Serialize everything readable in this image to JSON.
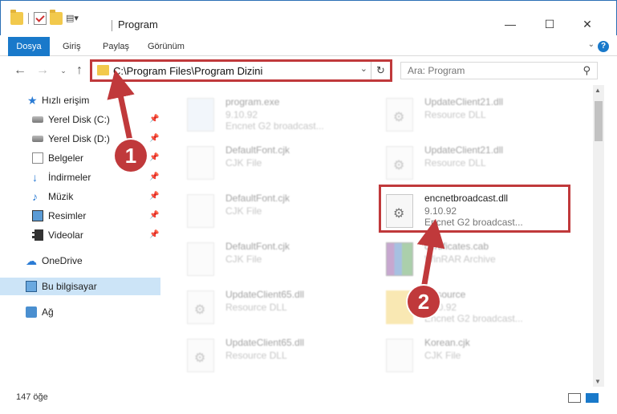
{
  "window": {
    "title": "Program",
    "minimize": "—",
    "maximize": "☐",
    "close": "✕"
  },
  "ribbon": {
    "tabs": [
      "Dosya",
      "Giriş",
      "Paylaş",
      "Görünüm"
    ],
    "help": "?"
  },
  "address": {
    "path": "C:\\Program Files\\Program Dizini",
    "search_placeholder": "Ara: Program"
  },
  "sidebar": {
    "items": [
      {
        "label": "Hızlı erişim",
        "icon": "star-icon"
      },
      {
        "label": "Yerel Disk (C:)",
        "icon": "disk-icon"
      },
      {
        "label": "Yerel Disk (D:)",
        "icon": "disk-icon"
      },
      {
        "label": "Belgeler",
        "icon": "documents-icon"
      },
      {
        "label": "İndirmeler",
        "icon": "download-icon"
      },
      {
        "label": "Müzik",
        "icon": "music-icon"
      },
      {
        "label": "Resimler",
        "icon": "pictures-icon"
      },
      {
        "label": "Videolar",
        "icon": "videos-icon"
      },
      {
        "label": "OneDrive",
        "icon": "cloud-icon"
      },
      {
        "label": "Bu bilgisayar",
        "icon": "computer-icon"
      },
      {
        "label": "Ağ",
        "icon": "network-icon"
      }
    ]
  },
  "files": [
    {
      "name": "program.exe",
      "line2": "9.10.92",
      "line3": "Encnet G2 broadcast..."
    },
    {
      "name": "UpdateClient21.dll",
      "line2": "Resource DLL",
      "line3": ""
    },
    {
      "name": "DefaultFont.cjk",
      "line2": "CJK File",
      "line3": ""
    },
    {
      "name": "UpdateClient21.dll",
      "line2": "Resource DLL",
      "line3": ""
    },
    {
      "name": "DefaultFont.cjk",
      "line2": "CJK File",
      "line3": ""
    },
    {
      "name": "encnetbroadcast.dll",
      "line2": "9.10.92",
      "line3": "Encnet G2 broadcast..."
    },
    {
      "name": "DefaultFont.cjk",
      "line2": "CJK File",
      "line3": ""
    },
    {
      "name": "certificates.cab",
      "line2": "WinRAR Archive",
      "line3": ""
    },
    {
      "name": "UpdateClient65.dll",
      "line2": "Resource DLL",
      "line3": ""
    },
    {
      "name": "Resource",
      "line2": "9.10.92",
      "line3": "Encnet G2 broadcast..."
    },
    {
      "name": "UpdateClient65.dll",
      "line2": "Resource DLL",
      "line3": ""
    },
    {
      "name": "Korean.cjk",
      "line2": "CJK File",
      "line3": ""
    }
  ],
  "status": {
    "count": "147 öğe"
  },
  "annotations": {
    "marker1": "1",
    "marker2": "2",
    "color": "#c0393b"
  }
}
